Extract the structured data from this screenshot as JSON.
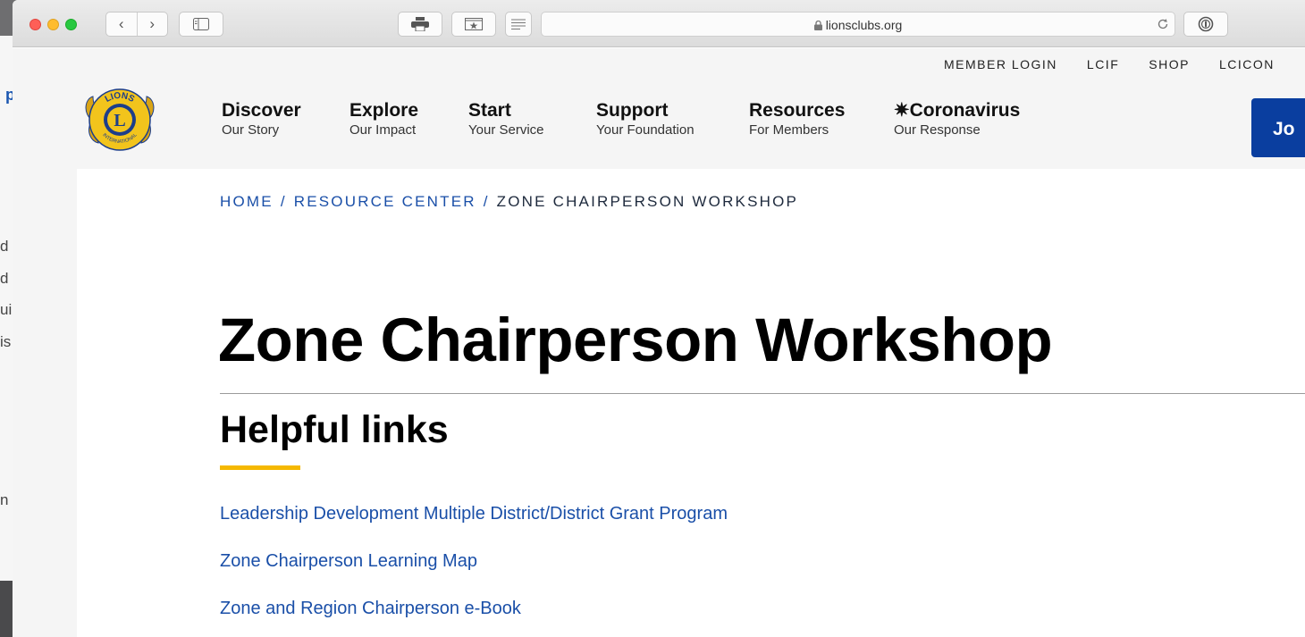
{
  "browser": {
    "url": "lionsclubs.org",
    "nav_back_glyph": "‹",
    "nav_forward_glyph": "›"
  },
  "utility_nav": [
    "MEMBER LOGIN",
    "LCIF",
    "SHOP",
    "LCICON"
  ],
  "main_nav": [
    {
      "title": "Discover",
      "subtitle": "Our Story"
    },
    {
      "title": "Explore",
      "subtitle": "Our Impact"
    },
    {
      "title": "Start",
      "subtitle": "Your Service"
    },
    {
      "title": "Support",
      "subtitle": "Your Foundation"
    },
    {
      "title": "Resources",
      "subtitle": "For Members"
    },
    {
      "title": "✷Coronavirus",
      "subtitle": "Our Response"
    }
  ],
  "join_button_label": "Jo",
  "logo": {
    "top_text": "LIONS",
    "letter": "L",
    "bottom_text": "INTERNATIONAL"
  },
  "breadcrumb": {
    "items": [
      "HOME",
      "RESOURCE CENTER"
    ],
    "separator": "/",
    "current": "ZONE CHAIRPERSON WORKSHOP"
  },
  "page_title": "Zone Chairperson Workshop",
  "section_heading": "Helpful links",
  "links": [
    "Leadership Development Multiple District/District Grant Program",
    "Zone Chairperson Learning Map",
    "Zone and Region Chairperson e-Book"
  ],
  "background_window_fragments": [
    "p",
    "d",
    "d",
    "ui",
    "is",
    "n"
  ],
  "colors": {
    "link_blue": "#1a4fa8",
    "brand_navy": "#0a3e9f",
    "accent_gold": "#f5b800"
  }
}
